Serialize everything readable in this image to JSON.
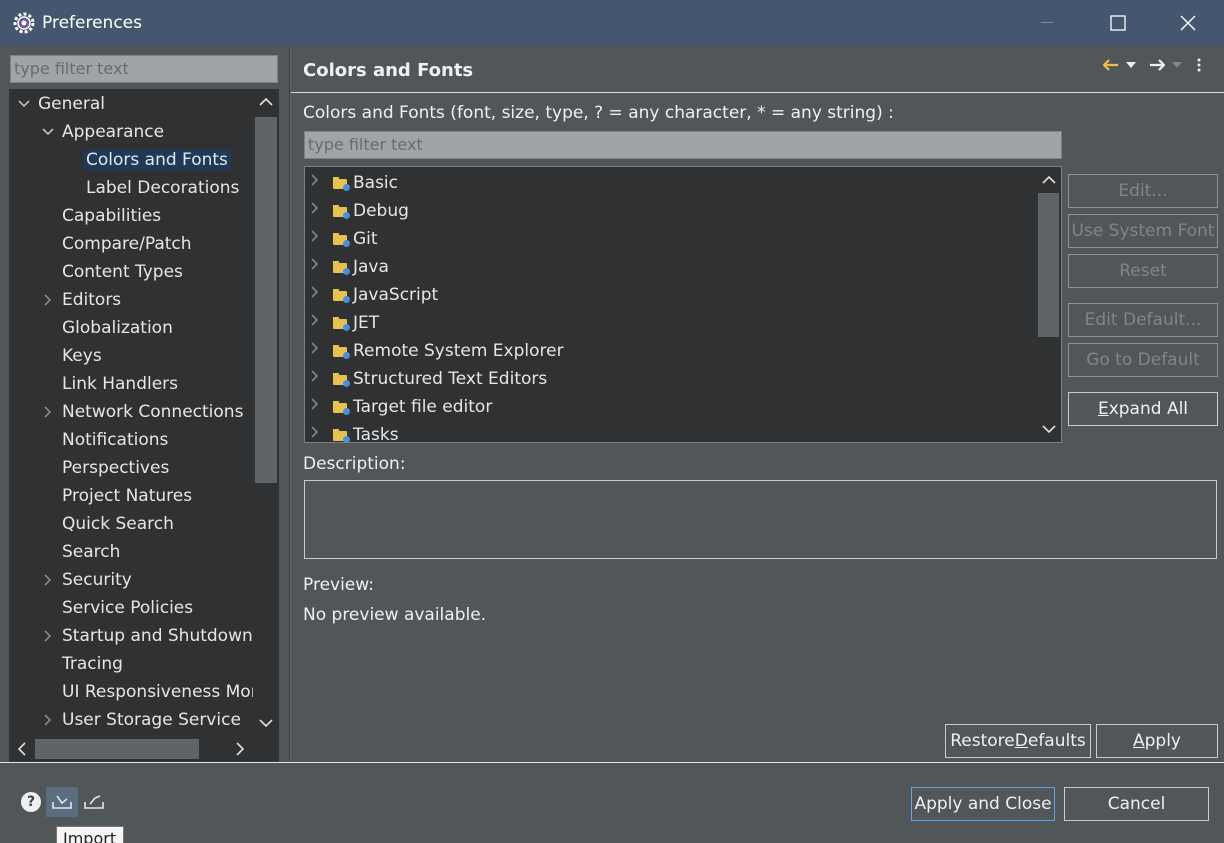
{
  "window": {
    "title": "Preferences",
    "controls": {
      "minimize": "—",
      "maximize": "☐",
      "close": "✕"
    }
  },
  "left": {
    "filter_placeholder": "type filter text",
    "tree": [
      {
        "label": "General",
        "level": 0,
        "arrow": "expanded"
      },
      {
        "label": "Appearance",
        "level": 1,
        "arrow": "expanded"
      },
      {
        "label": "Colors and Fonts",
        "level": 2,
        "arrow": "none",
        "selected": true
      },
      {
        "label": "Label Decorations",
        "level": 2,
        "arrow": "none"
      },
      {
        "label": "Capabilities",
        "level": 1,
        "arrow": "none"
      },
      {
        "label": "Compare/Patch",
        "level": 1,
        "arrow": "none"
      },
      {
        "label": "Content Types",
        "level": 1,
        "arrow": "none"
      },
      {
        "label": "Editors",
        "level": 1,
        "arrow": "collapsed"
      },
      {
        "label": "Globalization",
        "level": 1,
        "arrow": "none"
      },
      {
        "label": "Keys",
        "level": 1,
        "arrow": "none"
      },
      {
        "label": "Link Handlers",
        "level": 1,
        "arrow": "none"
      },
      {
        "label": "Network Connections",
        "level": 1,
        "arrow": "collapsed"
      },
      {
        "label": "Notifications",
        "level": 1,
        "arrow": "none"
      },
      {
        "label": "Perspectives",
        "level": 1,
        "arrow": "none"
      },
      {
        "label": "Project Natures",
        "level": 1,
        "arrow": "none"
      },
      {
        "label": "Quick Search",
        "level": 1,
        "arrow": "none"
      },
      {
        "label": "Search",
        "level": 1,
        "arrow": "none"
      },
      {
        "label": "Security",
        "level": 1,
        "arrow": "collapsed"
      },
      {
        "label": "Service Policies",
        "level": 1,
        "arrow": "none"
      },
      {
        "label": "Startup and Shutdown",
        "level": 1,
        "arrow": "collapsed"
      },
      {
        "label": "Tracing",
        "level": 1,
        "arrow": "none"
      },
      {
        "label": "UI Responsiveness Mon",
        "level": 1,
        "arrow": "none"
      },
      {
        "label": "User Storage Service",
        "level": 1,
        "arrow": "collapsed"
      }
    ]
  },
  "right": {
    "title": "Colors and Fonts",
    "filter_label": "Colors and Fonts (font, size, type, ? = any character, * = any string) :",
    "filter_placeholder": "type filter text",
    "categories": [
      "Basic",
      "Debug",
      "Git",
      "Java",
      "JavaScript",
      "JET",
      "Remote System Explorer",
      "Structured Text Editors",
      "Target file editor",
      "Tasks"
    ],
    "side_buttons": {
      "edit": "Edit...",
      "use_system_font": "Use System Font",
      "reset": "Reset",
      "edit_default": "Edit Default...",
      "go_to_default": "Go to Default",
      "expand_all": "Expand All"
    },
    "description_label": "Description:",
    "description_value": "",
    "preview_label": "Preview:",
    "preview_text": "No preview available.",
    "restore_defaults": "Restore Defaults",
    "apply": "Apply"
  },
  "footer": {
    "apply_and_close": "Apply and Close",
    "cancel": "Cancel",
    "tooltip": "Import"
  },
  "colors": {
    "titlebar": "#44576f",
    "background": "#515658",
    "tree_background": "#2f3133",
    "selection": "#1f3a58",
    "folder": "#e8c14e",
    "focus_border": "#5aa7e8"
  }
}
